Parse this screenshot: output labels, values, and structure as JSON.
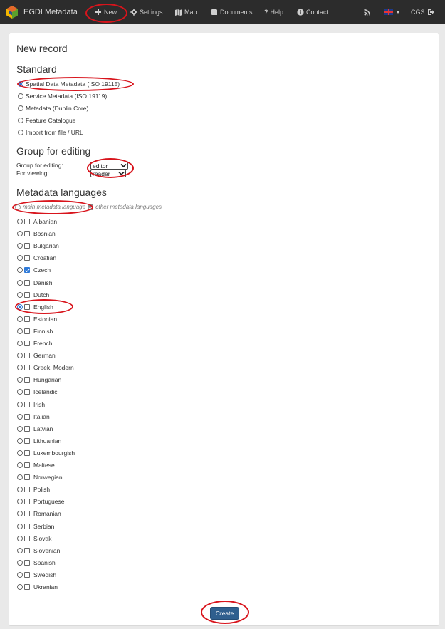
{
  "nav": {
    "brand": "EGDI Metadata",
    "items": [
      {
        "label": "New",
        "icon": "plus-icon"
      },
      {
        "label": "Settings",
        "icon": "gear-icon"
      },
      {
        "label": "Map",
        "icon": "map-icon"
      },
      {
        "label": "Documents",
        "icon": "book-icon"
      },
      {
        "label": "Help",
        "icon": "question-icon"
      },
      {
        "label": "Contact",
        "icon": "info-icon"
      }
    ],
    "user": "CGS"
  },
  "page": {
    "title": "New record",
    "standard_heading": "Standard",
    "standards": [
      {
        "label": "Spatial Data Metadata (ISO 19115)",
        "selected": true
      },
      {
        "label": "Service Metadata (ISO 19119)",
        "selected": false
      },
      {
        "label": "Metadata (Dublin Core)",
        "selected": false
      },
      {
        "label": "Feature Catalogue",
        "selected": false
      },
      {
        "label": "Import from file / URL",
        "selected": false
      }
    ],
    "group_heading": "Group for editing",
    "group_editing_label": "Group for editing:",
    "group_editing_value": "editor",
    "viewing_label": "For viewing:",
    "viewing_value": "reader",
    "languages_heading": "Metadata languages",
    "main_lang_label": "main metadata language",
    "other_lang_label": "other metadata languages",
    "languages": [
      {
        "name": "Albanian",
        "main": false,
        "other": false
      },
      {
        "name": "Bosnian",
        "main": false,
        "other": false
      },
      {
        "name": "Bulgarian",
        "main": false,
        "other": false
      },
      {
        "name": "Croatian",
        "main": false,
        "other": false
      },
      {
        "name": "Czech",
        "main": false,
        "other": true
      },
      {
        "name": "Danish",
        "main": false,
        "other": false
      },
      {
        "name": "Dutch",
        "main": false,
        "other": false
      },
      {
        "name": "English",
        "main": true,
        "other": false
      },
      {
        "name": "Estonian",
        "main": false,
        "other": false
      },
      {
        "name": "Finnish",
        "main": false,
        "other": false
      },
      {
        "name": "French",
        "main": false,
        "other": false
      },
      {
        "name": "German",
        "main": false,
        "other": false
      },
      {
        "name": "Greek, Modern",
        "main": false,
        "other": false
      },
      {
        "name": "Hungarian",
        "main": false,
        "other": false
      },
      {
        "name": "Icelandic",
        "main": false,
        "other": false
      },
      {
        "name": "Irish",
        "main": false,
        "other": false
      },
      {
        "name": "Italian",
        "main": false,
        "other": false
      },
      {
        "name": "Latvian",
        "main": false,
        "other": false
      },
      {
        "name": "Lithuanian",
        "main": false,
        "other": false
      },
      {
        "name": "Luxembourgish",
        "main": false,
        "other": false
      },
      {
        "name": "Maltese",
        "main": false,
        "other": false
      },
      {
        "name": "Norwegian",
        "main": false,
        "other": false
      },
      {
        "name": "Polish",
        "main": false,
        "other": false
      },
      {
        "name": "Portuguese",
        "main": false,
        "other": false
      },
      {
        "name": "Romanian",
        "main": false,
        "other": false
      },
      {
        "name": "Serbian",
        "main": false,
        "other": false
      },
      {
        "name": "Slovak",
        "main": false,
        "other": false
      },
      {
        "name": "Slovenian",
        "main": false,
        "other": false
      },
      {
        "name": "Spanish",
        "main": false,
        "other": false
      },
      {
        "name": "Swedish",
        "main": false,
        "other": false
      },
      {
        "name": "Ukranian",
        "main": false,
        "other": false
      }
    ],
    "create_label": "Create"
  },
  "colors": {
    "navbar": "#2c2c2c",
    "accent": "#2f7ad8",
    "button": "#2f5f8e",
    "annotation": "#d8141c"
  }
}
